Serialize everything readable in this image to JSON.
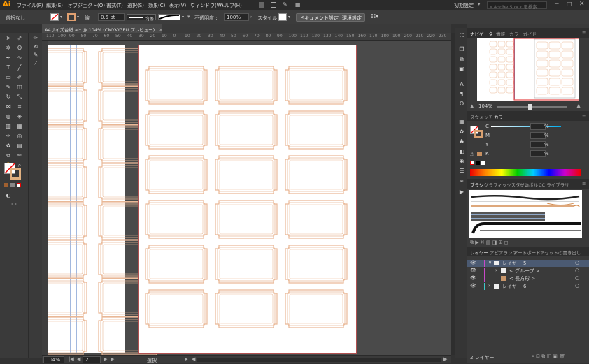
{
  "app": {
    "logo": "Ai"
  },
  "menu": [
    "ファイル(F)",
    "編集(E)",
    "オブジェクト(O)",
    "書式(T)",
    "選択(S)",
    "効果(C)",
    "表示(V)",
    "ウィンドウ(W)",
    "ヘルプ(H)"
  ],
  "workspace": "初期設定",
  "search_placeholder": "Adobe Stock を検索",
  "control": {
    "selection": "選択なし",
    "stroke_label": "線 :",
    "stroke_value": "0.5 pt",
    "stroke_profile": "均等",
    "opacity_label": "不透明度 :",
    "opacity_value": "100%",
    "style_label": "スタイル :",
    "doc_settings": "ドキュメント設定",
    "preferences": "環境設定"
  },
  "doc_tab": "A4サイズ台紙.ai* @ 104% (CMYK/GPU プレビュー)",
  "ruler_ticks": [
    "110",
    "100",
    "90",
    "80",
    "70",
    "60",
    "50",
    "40",
    "30",
    "20",
    "10",
    "0",
    "10",
    "20",
    "30",
    "40",
    "50",
    "60",
    "70",
    "80",
    "90",
    "100",
    "110",
    "120",
    "130",
    "140",
    "150",
    "160",
    "170",
    "180",
    "190",
    "200",
    "210",
    "220",
    "230"
  ],
  "status": {
    "zoom": "104%",
    "artboard": "2",
    "mode": "選択"
  },
  "navigator": {
    "tabs": [
      "ナビゲーター",
      "情報",
      "カラーガイド"
    ],
    "zoom": "104%"
  },
  "color_panel": {
    "tabs": [
      "スウォッチ",
      "カラー"
    ],
    "channels": [
      {
        "label": "C",
        "unit": "%"
      },
      {
        "label": "M",
        "unit": "%"
      },
      {
        "label": "Y",
        "unit": "%"
      },
      {
        "label": "K",
        "unit": "%"
      }
    ]
  },
  "brush_panel": {
    "tabs": [
      "ブラシ",
      "グラフィックスタイル",
      "シンボル",
      "CC ライブラリ"
    ]
  },
  "layers_panel": {
    "tabs": [
      "レイヤー",
      "アピアランス",
      "アートボード",
      "アセットの書き出し"
    ],
    "rows": [
      {
        "name": "レイヤー 5",
        "color": "#c848c8"
      },
      {
        "name": "< グループ >",
        "color": "#c848c8"
      },
      {
        "name": "< 長方形 >",
        "color": "#c848c8"
      },
      {
        "name": "レイヤー 6",
        "color": "#3ec8c8"
      }
    ],
    "footer": "2 レイヤー"
  },
  "colors": {
    "frame": "#e9b896",
    "accent": "#ff9a00",
    "artboard_border": "#b05050"
  }
}
